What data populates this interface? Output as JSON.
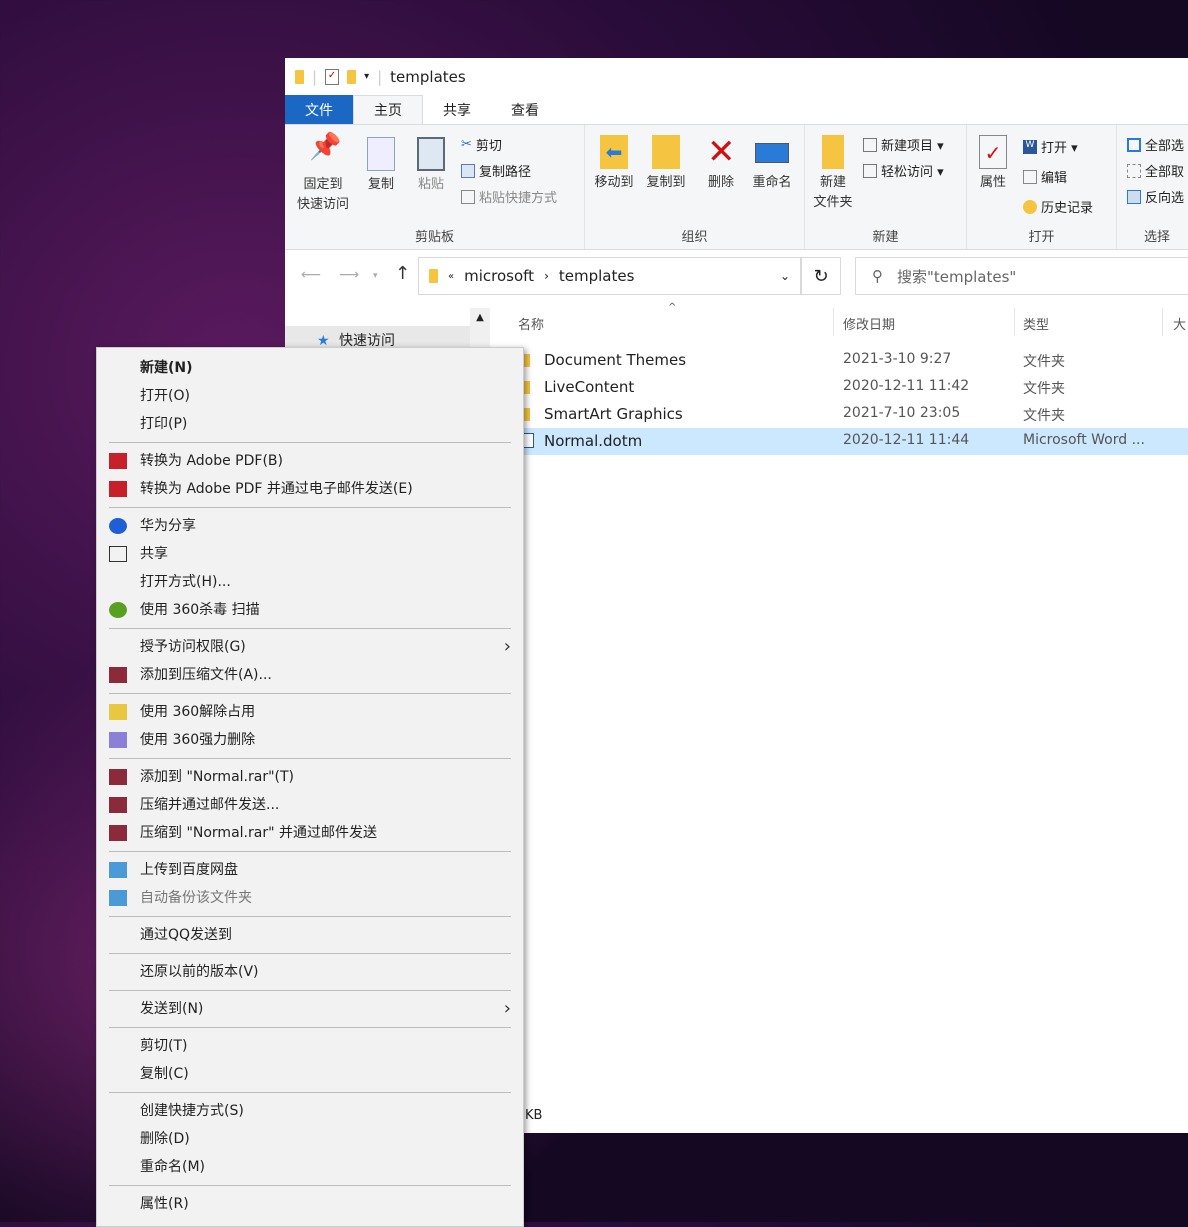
{
  "window": {
    "title": "templates",
    "tabs": [
      {
        "label": "文件"
      },
      {
        "label": "主页"
      },
      {
        "label": "共享"
      },
      {
        "label": "查看"
      }
    ],
    "ribbon": {
      "clipboard": {
        "label": "剪贴板",
        "pin": "固定到\n快速访问",
        "pin1": "固定到",
        "pin2": "快速访问",
        "copy": "复制",
        "paste": "粘贴",
        "cut": "剪切",
        "copy_path": "复制路径",
        "paste_shortcut": "粘贴快捷方式"
      },
      "organize": {
        "label": "组织",
        "move_to": "移动到",
        "copy_to": "复制到",
        "delete": "删除",
        "rename": "重命名"
      },
      "new": {
        "label": "新建",
        "new_folder1": "新建",
        "new_folder2": "文件夹",
        "new_item": "新建项目 ▾",
        "easy_access": "轻松访问 ▾"
      },
      "open": {
        "label": "打开",
        "properties": "属性",
        "open": "打开 ▾",
        "edit": "编辑",
        "history": "历史记录"
      },
      "select": {
        "label": "选择",
        "select_all": "全部选",
        "select_none": "全部取",
        "invert": "反向选"
      }
    },
    "address": {
      "crumbs": [
        "microsoft",
        "templates"
      ],
      "search_placeholder": "搜索\"templates\""
    },
    "sidebar": {
      "quick_access": "快速访问"
    },
    "columns": {
      "name": "名称",
      "date": "修改日期",
      "type": "类型",
      "size": "大"
    },
    "files": [
      {
        "name": "Document Themes",
        "date": "2021-3-10 9:27",
        "type": "文件夹",
        "kind": "folder"
      },
      {
        "name": "LiveContent",
        "date": "2020-12-11 11:42",
        "type": "文件夹",
        "kind": "folder"
      },
      {
        "name": "SmartArt Graphics",
        "date": "2021-7-10 23:05",
        "type": "文件夹",
        "kind": "folder"
      },
      {
        "name": "Normal.dotm",
        "date": "2020-12-11 11:44",
        "type": "Microsoft Word ...",
        "kind": "word",
        "selected": true
      }
    ],
    "status": "KB"
  },
  "context_menu": [
    {
      "label": "新建(N)",
      "bold": true
    },
    {
      "label": "打开(O)"
    },
    {
      "label": "打印(P)"
    },
    {
      "sep": true
    },
    {
      "label": "转换为 Adobe PDF(B)",
      "icon": "pdf"
    },
    {
      "label": "转换为 Adobe PDF 并通过电子邮件发送(E)",
      "icon": "pdf-mail"
    },
    {
      "sep": true
    },
    {
      "label": "华为分享",
      "icon": "huawei-share"
    },
    {
      "label": "共享",
      "icon": "share"
    },
    {
      "label": "打开方式(H)..."
    },
    {
      "label": "使用 360杀毒 扫描",
      "icon": "shield"
    },
    {
      "sep": true
    },
    {
      "label": "授予访问权限(G)",
      "submenu": true
    },
    {
      "label": "添加到压缩文件(A)...",
      "icon": "winrar"
    },
    {
      "sep": true
    },
    {
      "label": "使用 360解除占用",
      "icon": "unlock"
    },
    {
      "label": "使用 360强力删除",
      "icon": "shred"
    },
    {
      "sep": true
    },
    {
      "label": "添加到 \"Normal.rar\"(T)",
      "icon": "winrar"
    },
    {
      "label": "压缩并通过邮件发送...",
      "icon": "winrar"
    },
    {
      "label": "压缩到 \"Normal.rar\" 并通过邮件发送",
      "icon": "winrar"
    },
    {
      "sep": true
    },
    {
      "label": "上传到百度网盘",
      "icon": "baidu"
    },
    {
      "label": "自动备份该文件夹",
      "icon": "baidu",
      "disabled": true
    },
    {
      "sep": true
    },
    {
      "label": "通过QQ发送到"
    },
    {
      "sep": true
    },
    {
      "label": "还原以前的版本(V)"
    },
    {
      "sep": true
    },
    {
      "label": "发送到(N)",
      "submenu": true
    },
    {
      "sep": true
    },
    {
      "label": "剪切(T)"
    },
    {
      "label": "复制(C)"
    },
    {
      "sep": true
    },
    {
      "label": "创建快捷方式(S)"
    },
    {
      "label": "删除(D)"
    },
    {
      "label": "重命名(M)"
    },
    {
      "sep": true
    },
    {
      "label": "属性(R)"
    }
  ],
  "colors": {
    "accent": "#1a67c4",
    "selection": "#cce8ff",
    "folder": "#f5c542"
  }
}
